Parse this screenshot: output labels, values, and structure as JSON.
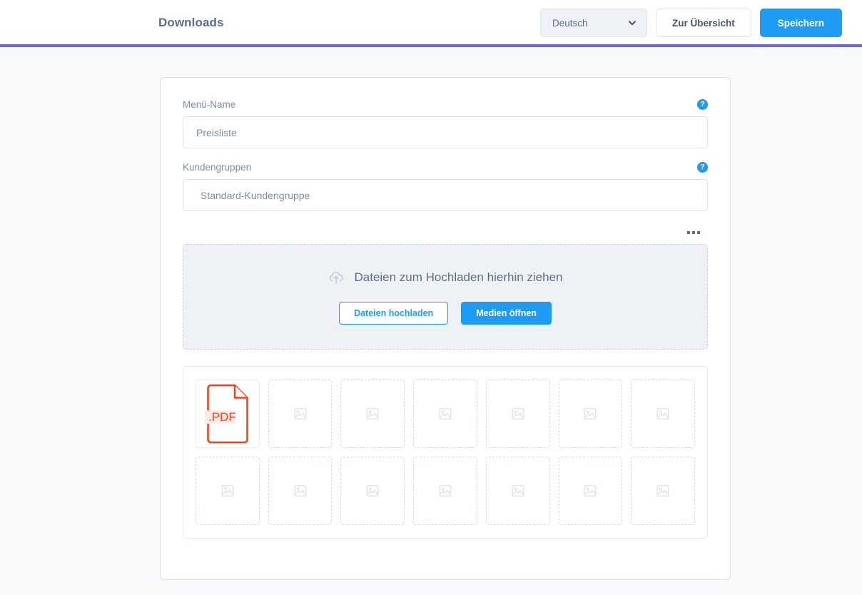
{
  "header": {
    "title": "Downloads",
    "language_select": {
      "value": "Deutsch",
      "chevron_icon": "chevron-down-icon"
    },
    "overview_button": "Zur Übersicht",
    "save_button": "Speichern",
    "accent_color": "#6e63f5"
  },
  "form": {
    "menu_name": {
      "label": "Menü-Name",
      "value": "Preisliste",
      "help_icon": "question-mark-icon",
      "help_glyph": "?"
    },
    "customer_groups": {
      "label": "Kundengruppen",
      "value": "Standard-Kundengruppe",
      "help_icon": "question-mark-icon",
      "help_glyph": "?"
    }
  },
  "media": {
    "overflow_menu_icon": "more-options-icon",
    "dropzone": {
      "cloud_icon": "cloud-upload-icon",
      "text": "Dateien zum Hochladen hierhin ziehen",
      "upload_button": "Dateien hochladen",
      "open_media_button": "Medien öffnen",
      "upload_button_color": "#1e9bf5",
      "open_media_button_color": "#1e9bf5"
    },
    "grid": {
      "columns": 7,
      "rows": 2,
      "placeholder_icon": "image-placeholder-icon",
      "cells": [
        {
          "type": "file",
          "file_type": ".PDF",
          "icon": "pdf-file-icon",
          "color": "#f4441e"
        },
        {
          "type": "empty"
        },
        {
          "type": "empty"
        },
        {
          "type": "empty"
        },
        {
          "type": "empty"
        },
        {
          "type": "empty"
        },
        {
          "type": "empty"
        },
        {
          "type": "empty"
        },
        {
          "type": "empty"
        },
        {
          "type": "empty"
        },
        {
          "type": "empty"
        },
        {
          "type": "empty"
        },
        {
          "type": "empty"
        },
        {
          "type": "empty"
        }
      ]
    }
  }
}
